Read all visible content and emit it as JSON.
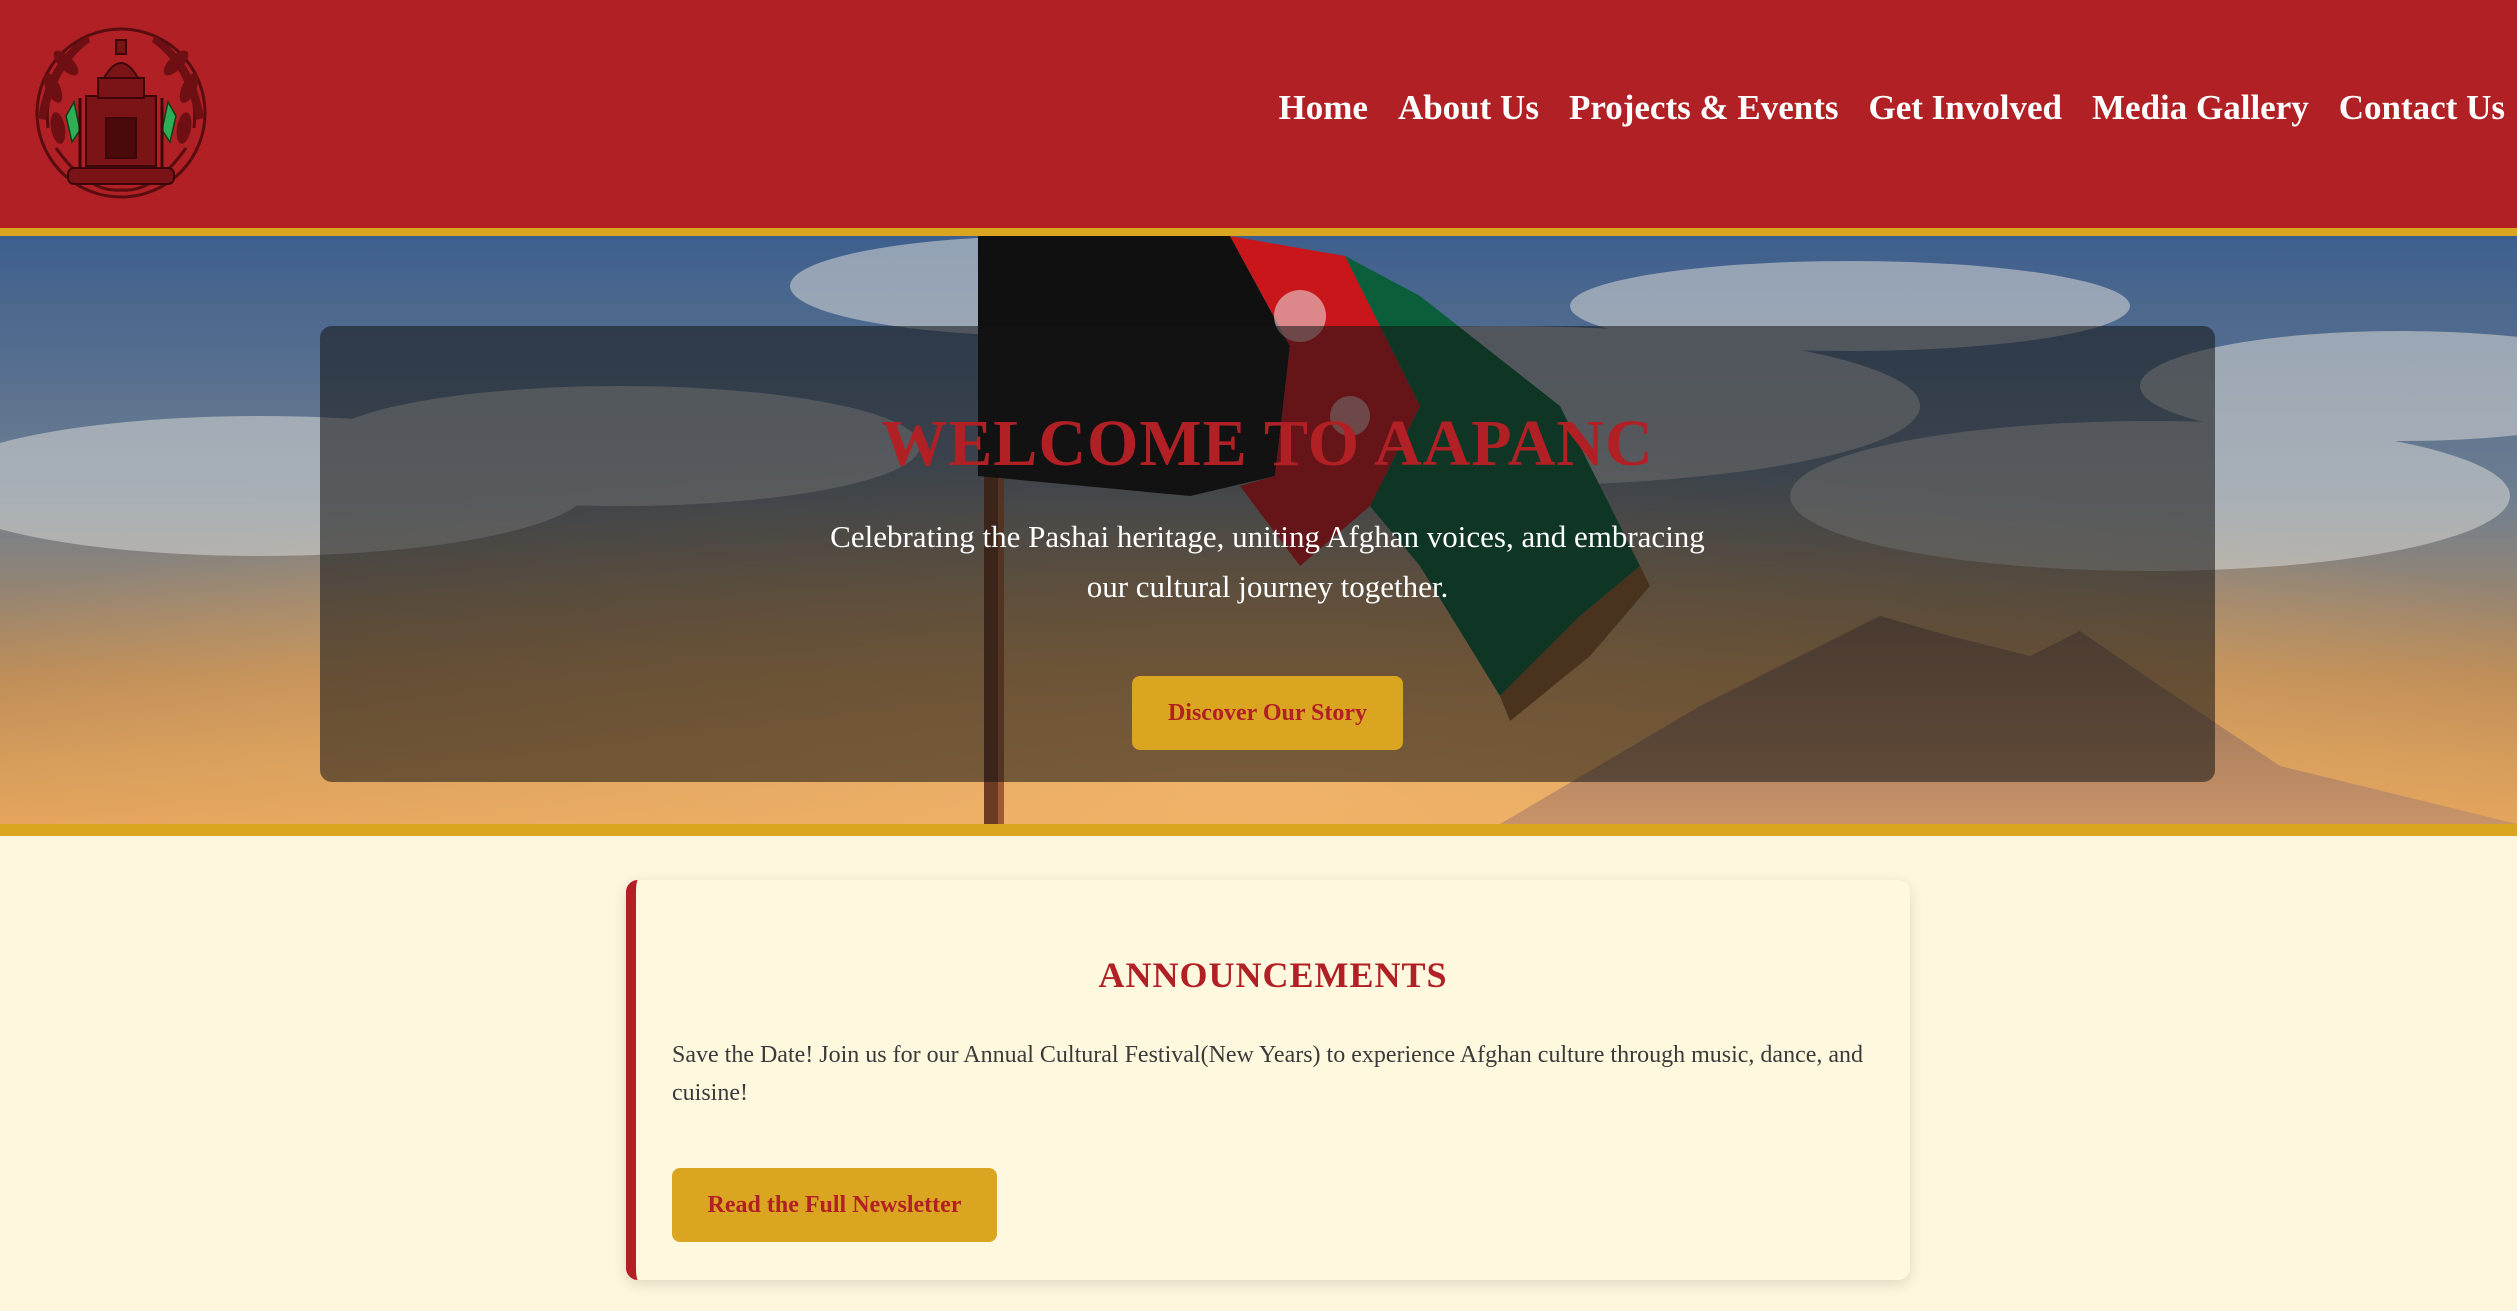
{
  "header": {
    "logo_icon": "afghan-emblem-icon",
    "nav": [
      {
        "label": "Home"
      },
      {
        "label": "About Us"
      },
      {
        "label": "Projects & Events"
      },
      {
        "label": "Get Involved"
      },
      {
        "label": "Media Gallery"
      },
      {
        "label": "Contact Us"
      }
    ]
  },
  "hero": {
    "background": "afghan-flag-sky-mountain-photo",
    "title": "WELCOME TO AAPANC",
    "subtitle_line1": "Celebrating the Pashai heritage, uniting Afghan voices, and embracing",
    "subtitle_line2": "our cultural journey together.",
    "cta_label": "Discover Our Story"
  },
  "announcements": {
    "title": "ANNOUNCEMENTS",
    "text": "Save the Date! Join us for our Annual Cultural Festival(New Years) to experience Afghan culture through music, dance, and cuisine!",
    "button_label": "Read the Full Newsletter"
  },
  "colors": {
    "primary_red": "#b12024",
    "gold": "#daa520",
    "cream": "#fdf6dc"
  }
}
